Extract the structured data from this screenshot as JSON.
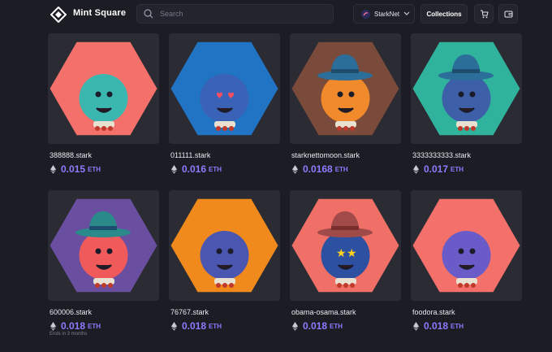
{
  "header": {
    "brand": "Mint Square",
    "search_placeholder": "Search",
    "network_label": "StarkNet",
    "collections_label": "Collections"
  },
  "colors": {
    "background": "#1c1d24",
    "card": "#2b2c33",
    "accent": "#8b7cff"
  },
  "price_unit": "ETH",
  "cards": [
    {
      "name": "388888.stark",
      "price": "0.015",
      "bg": "#f4706b",
      "body": "#3cb7b0",
      "hat": "none",
      "icon": "bone-pig-avatar"
    },
    {
      "name": "011111.stark",
      "price": "0.016",
      "bg": "#2173c4",
      "body": "#3a63b8",
      "hat": "none",
      "icon": "heart-eyes-berry-avatar"
    },
    {
      "name": "starknettomoon.stark",
      "price": "0.0168",
      "bg": "#7a4a3a",
      "body": "#f08a2a",
      "hat": "blue",
      "icon": "viking-winker-avatar"
    },
    {
      "name": "3333333333.stark",
      "price": "0.017",
      "bg": "#2fb39c",
      "body": "#3d5fa8",
      "hat": "blue",
      "icon": "arrow-worried-avatar"
    },
    {
      "name": "600006.stark",
      "price": "0.018",
      "bg": "#6a4ea0",
      "body": "#f05a5a",
      "hat": "teal",
      "icon": "scared-lobster-avatar",
      "note": "Ends in 3 months"
    },
    {
      "name": "76767.stark",
      "price": "0.018",
      "bg": "#f08a1c",
      "body": "#4a56b0",
      "hat": "none",
      "icon": "raindrop-football-avatar"
    },
    {
      "name": "obama-osama.stark",
      "price": "0.018",
      "bg": "#f07068",
      "body": "#2e50a0",
      "hat": "brown",
      "icon": "cowboy-stars-avatar"
    },
    {
      "name": "foodora.stark",
      "price": "0.018",
      "bg": "#f4706b",
      "body": "#6a5cc8",
      "hat": "none",
      "icon": "duck-beer-avatar"
    }
  ]
}
